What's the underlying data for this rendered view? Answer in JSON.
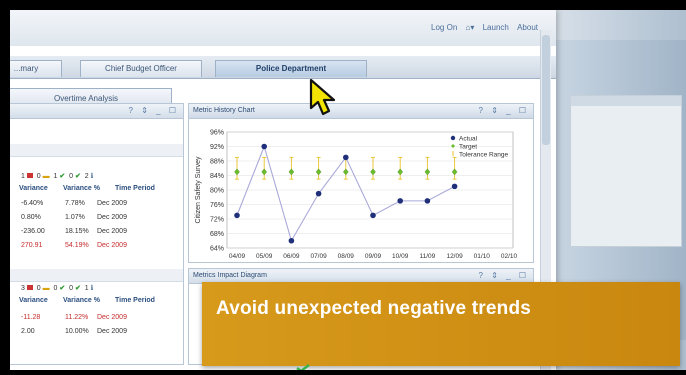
{
  "header": {
    "links": [
      "Log On",
      "Launch",
      "About"
    ]
  },
  "tabs": [
    {
      "label": "...mary"
    },
    {
      "label": "Chief Budget Officer"
    },
    {
      "label": "Police Department",
      "active": true
    }
  ],
  "subtab": {
    "label": "Overtime Analysis"
  },
  "left_panel": {
    "status_row_1": {
      "red_count": "1",
      "yellow_count": "0",
      "green_count_a": "1",
      "green_count_b": "0",
      "blue_count": "2"
    },
    "columns": [
      "Variance",
      "Variance %",
      "Time Period"
    ],
    "rows": [
      {
        "variance": "-6.40%",
        "variance_pct": "7.78%",
        "period": "Dec 2009",
        "red": false
      },
      {
        "variance": "0.80%",
        "variance_pct": "1.07%",
        "period": "Dec 2009",
        "red": false
      },
      {
        "variance": "-236.00",
        "variance_pct": "18.15%",
        "period": "Dec 2009",
        "red": false
      },
      {
        "variance": "270.91",
        "variance_pct": "54.19%",
        "period": "Dec 2009",
        "red": true
      }
    ],
    "status_row_2": {
      "red_count": "3",
      "yellow_count": "0",
      "green_count_a": "0",
      "green_count_b": "0",
      "blue_count": "1"
    },
    "columns_2": [
      "Variance",
      "Variance %",
      "Time Period"
    ],
    "rows_2": [
      {
        "variance": "-11.28",
        "variance_pct": "11.22%",
        "period": "Dec 2009",
        "red": true
      },
      {
        "variance": "2.00",
        "variance_pct": "10.00%",
        "period": "Dec 2009",
        "red": false
      }
    ]
  },
  "chart_panel": {
    "title": "Metric History Chart",
    "icons": [
      "help-icon",
      "settings-icon",
      "minimize-icon",
      "maximize-icon"
    ]
  },
  "impact_panel": {
    "title": "Metrics Impact Diagram"
  },
  "banner": {
    "text": "Avoid unexpected negative trends",
    "color": "#d08f15"
  },
  "chart_data": {
    "type": "line",
    "ylabel": "Citizen Safety Survey",
    "xlabel": "",
    "categories": [
      "04/09",
      "05/09",
      "06/09",
      "07/09",
      "08/09",
      "09/09",
      "10/09",
      "11/09",
      "12/09",
      "01/10",
      "02/10"
    ],
    "yticks": [
      "96%",
      "92%",
      "88%",
      "84%",
      "80%",
      "76%",
      "72%",
      "68%",
      "64%"
    ],
    "ylim": [
      64,
      96
    ],
    "legend_position": "top-right",
    "series": [
      {
        "name": "Actual",
        "color": "#1f2f7a",
        "values": [
          73,
          92,
          66,
          79,
          89,
          73,
          77,
          77,
          81,
          null,
          null
        ]
      },
      {
        "name": "Target",
        "color": "#6cbf2a",
        "values": [
          85,
          85,
          85,
          85,
          85,
          85,
          85,
          85,
          85,
          null,
          null
        ]
      },
      {
        "name": "Tolerance Range",
        "color": "#e8c22a",
        "range": [
          [
            83,
            89
          ],
          [
            83,
            89
          ],
          [
            83,
            89
          ],
          [
            83,
            89
          ],
          [
            83,
            89
          ],
          [
            83,
            89
          ],
          [
            83,
            89
          ],
          [
            83,
            89
          ],
          [
            83,
            89
          ]
        ]
      }
    ],
    "grid": true
  }
}
